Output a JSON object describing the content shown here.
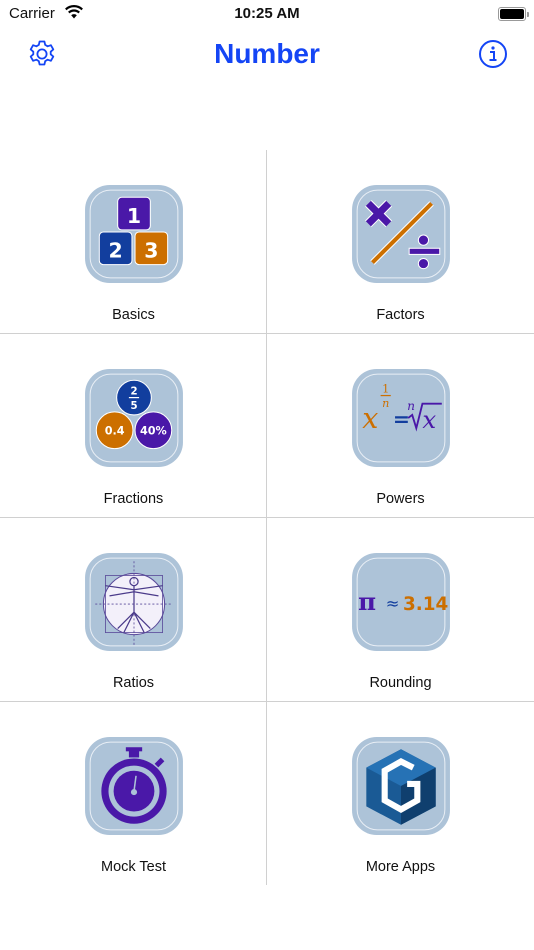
{
  "status_bar": {
    "carrier": "Carrier",
    "time": "10:25 AM",
    "wifi_icon": "wifi-icon",
    "battery_icon": "battery-full-icon"
  },
  "nav": {
    "title": "Number",
    "left_icon": "gear-icon",
    "right_icon": "info-icon",
    "accent_color": "#1445f5"
  },
  "menu": {
    "items": [
      {
        "label": "Basics",
        "icon": "number-blocks-icon",
        "blocks": [
          "1",
          "2",
          "3"
        ]
      },
      {
        "label": "Factors",
        "icon": "multiply-divide-icon"
      },
      {
        "label": "Fractions",
        "icon": "fraction-decimal-percent-icon",
        "circles": {
          "fraction_num": "2",
          "fraction_den": "5",
          "decimal": "0.4",
          "percent": "40%"
        }
      },
      {
        "label": "Powers",
        "icon": "powers-roots-icon",
        "formula": {
          "base": "x",
          "exp_num": "1",
          "exp_den": "n",
          "equals": "=",
          "root_index": "n",
          "radicand": "x"
        }
      },
      {
        "label": "Ratios",
        "icon": "vitruvian-man-icon"
      },
      {
        "label": "Rounding",
        "icon": "pi-approx-icon",
        "formula": {
          "pi": "π",
          "approx": "≈",
          "value": "3.14"
        }
      },
      {
        "label": "Mock Test",
        "icon": "stopwatch-icon"
      },
      {
        "label": "More Apps",
        "icon": "g-cube-logo-icon"
      }
    ]
  },
  "colors": {
    "tile_bg": "#adc3d8",
    "purple": "#4a18a8",
    "blue": "#123e9e",
    "orange": "#cc6f00",
    "divider": "#d0d0d0"
  }
}
